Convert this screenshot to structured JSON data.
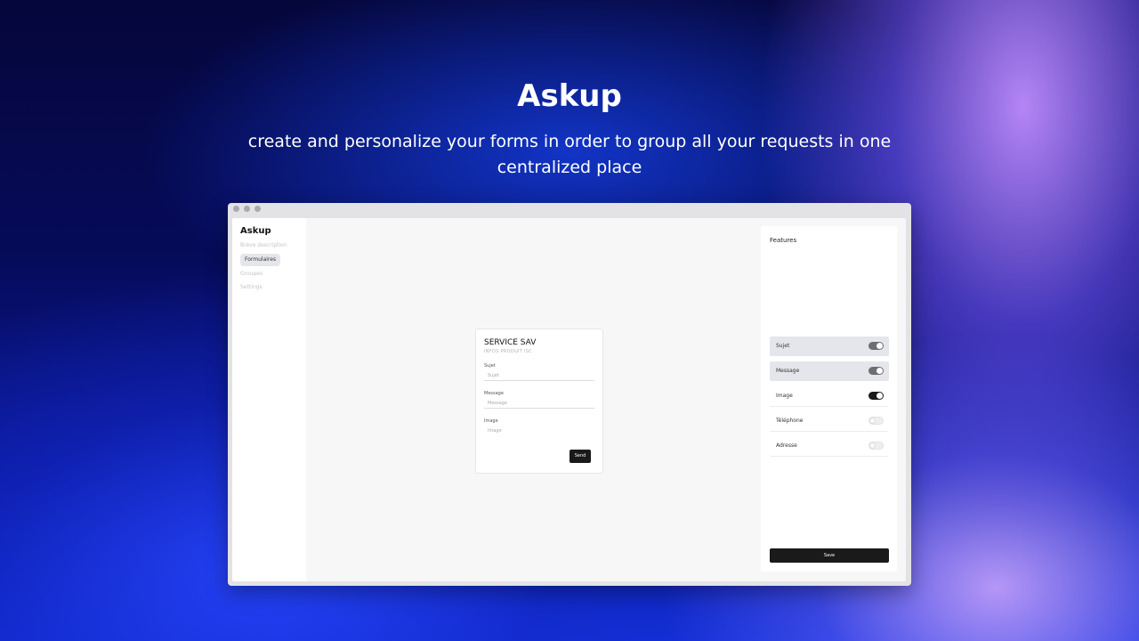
{
  "hero": {
    "title": "Askup",
    "subtitle": "create and personalize your forms in order to group all your requests in one centralized place"
  },
  "sidebar": {
    "logo": "Askup",
    "items": [
      {
        "label": "Brève description"
      },
      {
        "label": "Formulaires"
      },
      {
        "label": "Groupes"
      },
      {
        "label": "Settings"
      }
    ]
  },
  "form": {
    "title": "SERVICE SAV",
    "subtitle": "INFOS PRODUIT ISC",
    "fields": [
      {
        "label": "Sujet",
        "placeholder": "Sujet"
      },
      {
        "label": "Message",
        "placeholder": "Message"
      },
      {
        "label": "Image",
        "placeholder": "Image"
      }
    ],
    "send_label": "Send"
  },
  "features": {
    "title": "Features",
    "items": [
      {
        "label": "Sujet",
        "enabled": true
      },
      {
        "label": "Message",
        "enabled": true
      },
      {
        "label": "Image",
        "enabled": true
      },
      {
        "label": "Téléphone",
        "enabled": false
      },
      {
        "label": "Adresse",
        "enabled": false
      }
    ],
    "save_label": "Save"
  }
}
